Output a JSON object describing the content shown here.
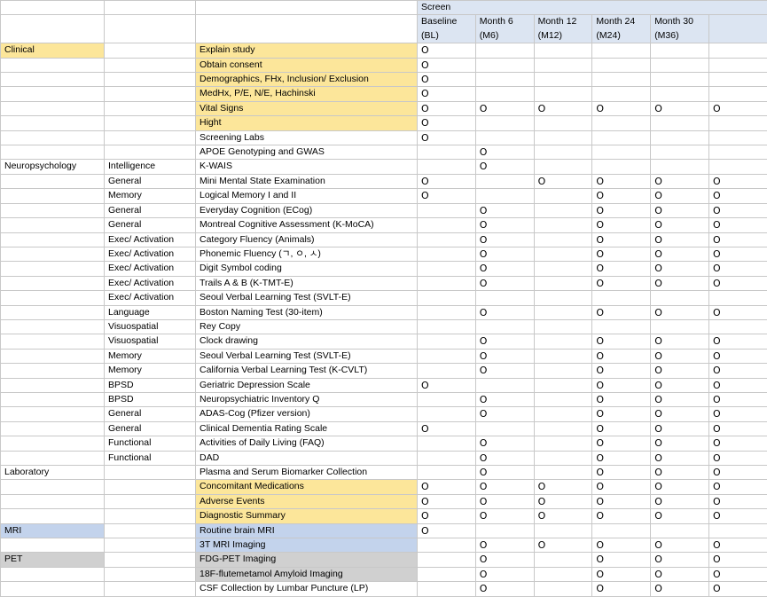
{
  "table": {
    "headers": {
      "domain": "",
      "subdomain": "",
      "item": "",
      "visits": [
        "Screen",
        "Baseline (BL)",
        "Month 6 (M6)",
        "Month 12 (M12)",
        "Month 24 (M24)",
        "Month 30 (M36)"
      ],
      "visits_lines": [
        [
          "Screen"
        ],
        [
          "Baseline",
          "(BL)"
        ],
        [
          "Month 6",
          "(M6)"
        ],
        [
          "Month 12",
          "(M12)"
        ],
        [
          "Month 24",
          "(M24)"
        ],
        [
          "Month 30",
          "(M36)"
        ]
      ]
    },
    "marker": "O",
    "colors": {
      "clinical": "#fce69a",
      "laboratory": "#f7cdd1",
      "neuropsychology": "#dcead0",
      "mri": "#c3d3ec",
      "pet": "#d0d0d0",
      "header": "#dce5f2",
      "grid": "#c8c8c8"
    },
    "rows": [
      {
        "domain": "Clinical",
        "domain_bg": "clinical",
        "subdomain": "",
        "subdomain_bg": "white",
        "item": "Explain study",
        "item_bg": "clinical",
        "marks": [
          true,
          false,
          false,
          false,
          false,
          false
        ]
      },
      {
        "domain": "",
        "domain_bg": "white",
        "subdomain": "",
        "subdomain_bg": "white",
        "item": "Obtain consent",
        "item_bg": "clinical",
        "marks": [
          true,
          false,
          false,
          false,
          false,
          false
        ]
      },
      {
        "domain": "",
        "domain_bg": "white",
        "subdomain": "",
        "subdomain_bg": "white",
        "item": "Demographics, FHx, Inclusion/ Exclusion",
        "item_bg": "clinical",
        "marks": [
          true,
          false,
          false,
          false,
          false,
          false
        ]
      },
      {
        "domain": "",
        "domain_bg": "white",
        "subdomain": "",
        "subdomain_bg": "white",
        "item": "MedHx, P/E, N/E, Hachinski",
        "item_bg": "clinical",
        "marks": [
          true,
          false,
          false,
          false,
          false,
          false
        ]
      },
      {
        "domain": "",
        "domain_bg": "white",
        "subdomain": "",
        "subdomain_bg": "white",
        "item": "Vital Signs",
        "item_bg": "clinical",
        "marks": [
          true,
          true,
          true,
          true,
          true,
          true
        ]
      },
      {
        "domain": "",
        "domain_bg": "white",
        "subdomain": "",
        "subdomain_bg": "white",
        "item": "Hight",
        "item_bg": "clinical",
        "marks": [
          true,
          false,
          false,
          false,
          false,
          false
        ]
      },
      {
        "domain": "",
        "domain_bg": "white",
        "subdomain": "",
        "subdomain_bg": "white",
        "item": "Screening Labs",
        "item_bg": "laboratory",
        "marks": [
          true,
          false,
          false,
          false,
          false,
          false
        ]
      },
      {
        "domain": "",
        "domain_bg": "white",
        "subdomain": "",
        "subdomain_bg": "white",
        "item": "APOE Genotyping and GWAS",
        "item_bg": "laboratory",
        "marks": [
          false,
          true,
          false,
          false,
          false,
          false
        ]
      },
      {
        "domain": "Neuropsychology",
        "domain_bg": "neuropsychology",
        "subdomain": "Intelligence",
        "subdomain_bg": "white",
        "item": "K-WAIS",
        "item_bg": "neuropsychology",
        "marks": [
          false,
          true,
          false,
          false,
          false,
          false
        ]
      },
      {
        "domain": "",
        "domain_bg": "white",
        "subdomain": "General",
        "subdomain_bg": "white",
        "item": "Mini Mental State Examination",
        "item_bg": "neuropsychology",
        "marks": [
          true,
          false,
          true,
          true,
          true,
          true
        ]
      },
      {
        "domain": "",
        "domain_bg": "white",
        "subdomain": "Memory",
        "subdomain_bg": "white",
        "item": "Logical Memory I and II",
        "item_bg": "neuropsychology",
        "marks": [
          true,
          false,
          false,
          true,
          true,
          true
        ]
      },
      {
        "domain": "",
        "domain_bg": "white",
        "subdomain": "General",
        "subdomain_bg": "white",
        "item": "Everyday Cognition (ECog)",
        "item_bg": "neuropsychology",
        "marks": [
          false,
          true,
          false,
          true,
          true,
          true
        ]
      },
      {
        "domain": "",
        "domain_bg": "white",
        "subdomain": "General",
        "subdomain_bg": "white",
        "item": "Montreal Cognitive Assessment (K-MoCA)",
        "item_bg": "neuropsychology",
        "marks": [
          false,
          true,
          false,
          true,
          true,
          true
        ]
      },
      {
        "domain": "",
        "domain_bg": "white",
        "subdomain": "Exec/ Activation",
        "subdomain_bg": "white",
        "item": "Category Fluency (Animals)",
        "item_bg": "neuropsychology",
        "marks": [
          false,
          true,
          false,
          true,
          true,
          true
        ]
      },
      {
        "domain": "",
        "domain_bg": "white",
        "subdomain": "Exec/ Activation",
        "subdomain_bg": "white",
        "item": "Phonemic Fluency (ㄱ, ㅇ, ㅅ)",
        "item_bg": "neuropsychology",
        "marks": [
          false,
          true,
          false,
          true,
          true,
          true
        ]
      },
      {
        "domain": "",
        "domain_bg": "white",
        "subdomain": "Exec/ Activation",
        "subdomain_bg": "white",
        "item": "Digit Symbol coding",
        "item_bg": "neuropsychology",
        "marks": [
          false,
          true,
          false,
          true,
          true,
          true
        ]
      },
      {
        "domain": "",
        "domain_bg": "white",
        "subdomain": "Exec/ Activation",
        "subdomain_bg": "white",
        "item": "Trails A & B (K-TMT-E)",
        "item_bg": "neuropsychology",
        "marks": [
          false,
          true,
          false,
          true,
          true,
          true
        ]
      },
      {
        "domain": "",
        "domain_bg": "white",
        "subdomain": "Exec/ Activation",
        "subdomain_bg": "white",
        "item": "Seoul Verbal Learning Test (SVLT-E)",
        "item_bg": "neuropsychology",
        "marks": [
          false,
          false,
          false,
          false,
          false,
          false
        ]
      },
      {
        "domain": "",
        "domain_bg": "white",
        "subdomain": "Language",
        "subdomain_bg": "white",
        "item": "Boston Naming Test (30-item)",
        "item_bg": "neuropsychology",
        "marks": [
          false,
          true,
          false,
          true,
          true,
          true
        ]
      },
      {
        "domain": "",
        "domain_bg": "white",
        "subdomain": "Visuospatial",
        "subdomain_bg": "white",
        "item": "Rey Copy",
        "item_bg": "neuropsychology",
        "marks": [
          false,
          false,
          false,
          false,
          false,
          false
        ]
      },
      {
        "domain": "",
        "domain_bg": "white",
        "subdomain": "Visuospatial",
        "subdomain_bg": "white",
        "item": "Clock drawing",
        "item_bg": "neuropsychology",
        "marks": [
          false,
          true,
          false,
          true,
          true,
          true
        ]
      },
      {
        "domain": "",
        "domain_bg": "white",
        "subdomain": "Memory",
        "subdomain_bg": "white",
        "item": "Seoul Verbal Learning Test (SVLT-E)",
        "item_bg": "neuropsychology",
        "marks": [
          false,
          true,
          false,
          true,
          true,
          true
        ]
      },
      {
        "domain": "",
        "domain_bg": "white",
        "subdomain": "Memory",
        "subdomain_bg": "white",
        "item": "California Verbal Learning Test (K-CVLT)",
        "item_bg": "neuropsychology",
        "marks": [
          false,
          true,
          false,
          true,
          true,
          true
        ]
      },
      {
        "domain": "",
        "domain_bg": "white",
        "subdomain": "BPSD",
        "subdomain_bg": "white",
        "item": "Geriatric Depression Scale",
        "item_bg": "neuropsychology",
        "marks": [
          true,
          false,
          false,
          true,
          true,
          true
        ]
      },
      {
        "domain": "",
        "domain_bg": "white",
        "subdomain": "BPSD",
        "subdomain_bg": "white",
        "item": "Neuropsychiatric Inventory Q",
        "item_bg": "neuropsychology",
        "marks": [
          false,
          true,
          false,
          true,
          true,
          true
        ]
      },
      {
        "domain": "",
        "domain_bg": "white",
        "subdomain": "General",
        "subdomain_bg": "white",
        "item": "ADAS-Cog (Pfizer version)",
        "item_bg": "neuropsychology",
        "marks": [
          false,
          true,
          false,
          true,
          true,
          true
        ]
      },
      {
        "domain": "",
        "domain_bg": "white",
        "subdomain": "General",
        "subdomain_bg": "white",
        "item": "Clinical Dementia Rating Scale",
        "item_bg": "neuropsychology",
        "marks": [
          true,
          false,
          false,
          true,
          true,
          true
        ]
      },
      {
        "domain": "",
        "domain_bg": "white",
        "subdomain": "Functional",
        "subdomain_bg": "white",
        "item": "Activities of Daily Living (FAQ)",
        "item_bg": "neuropsychology",
        "marks": [
          false,
          true,
          false,
          true,
          true,
          true
        ]
      },
      {
        "domain": "",
        "domain_bg": "white",
        "subdomain": "Functional",
        "subdomain_bg": "white",
        "item": "DAD",
        "item_bg": "neuropsychology",
        "marks": [
          false,
          true,
          false,
          true,
          true,
          true
        ]
      },
      {
        "domain": "Laboratory",
        "domain_bg": "laboratory",
        "subdomain": "",
        "subdomain_bg": "white",
        "item": "Plasma and Serum Biomarker Collection",
        "item_bg": "laboratory",
        "marks": [
          false,
          true,
          false,
          true,
          true,
          true
        ]
      },
      {
        "domain": "",
        "domain_bg": "white",
        "subdomain": "",
        "subdomain_bg": "white",
        "item": "Concomitant Medications",
        "item_bg": "clinical",
        "marks": [
          true,
          true,
          true,
          true,
          true,
          true
        ]
      },
      {
        "domain": "",
        "domain_bg": "white",
        "subdomain": "",
        "subdomain_bg": "white",
        "item": "Adverse Events",
        "item_bg": "clinical",
        "marks": [
          true,
          true,
          true,
          true,
          true,
          true
        ]
      },
      {
        "domain": "",
        "domain_bg": "white",
        "subdomain": "",
        "subdomain_bg": "white",
        "item": "Diagnostic Summary",
        "item_bg": "clinical",
        "marks": [
          true,
          true,
          true,
          true,
          true,
          true
        ]
      },
      {
        "domain": "MRI",
        "domain_bg": "mri",
        "subdomain": "",
        "subdomain_bg": "white",
        "item": "Routine brain MRI",
        "item_bg": "mri",
        "marks": [
          true,
          false,
          false,
          false,
          false,
          false
        ]
      },
      {
        "domain": "",
        "domain_bg": "white",
        "subdomain": "",
        "subdomain_bg": "white",
        "item": "3T MRI Imaging",
        "item_bg": "mri",
        "marks": [
          false,
          true,
          true,
          true,
          true,
          true
        ]
      },
      {
        "domain": "PET",
        "domain_bg": "pet",
        "subdomain": "",
        "subdomain_bg": "white",
        "item": "FDG-PET Imaging",
        "item_bg": "pet",
        "marks": [
          false,
          true,
          false,
          true,
          true,
          true
        ]
      },
      {
        "domain": "",
        "domain_bg": "white",
        "subdomain": "",
        "subdomain_bg": "white",
        "item": "18F-flutemetamol Amyloid Imaging",
        "item_bg": "pet",
        "marks": [
          false,
          true,
          false,
          true,
          true,
          true
        ]
      },
      {
        "domain": "",
        "domain_bg": "white",
        "subdomain": "",
        "subdomain_bg": "white",
        "item": "CSF Collection by Lumbar Puncture (LP)",
        "item_bg": "laboratory",
        "marks": [
          false,
          true,
          false,
          true,
          true,
          true
        ]
      }
    ]
  }
}
